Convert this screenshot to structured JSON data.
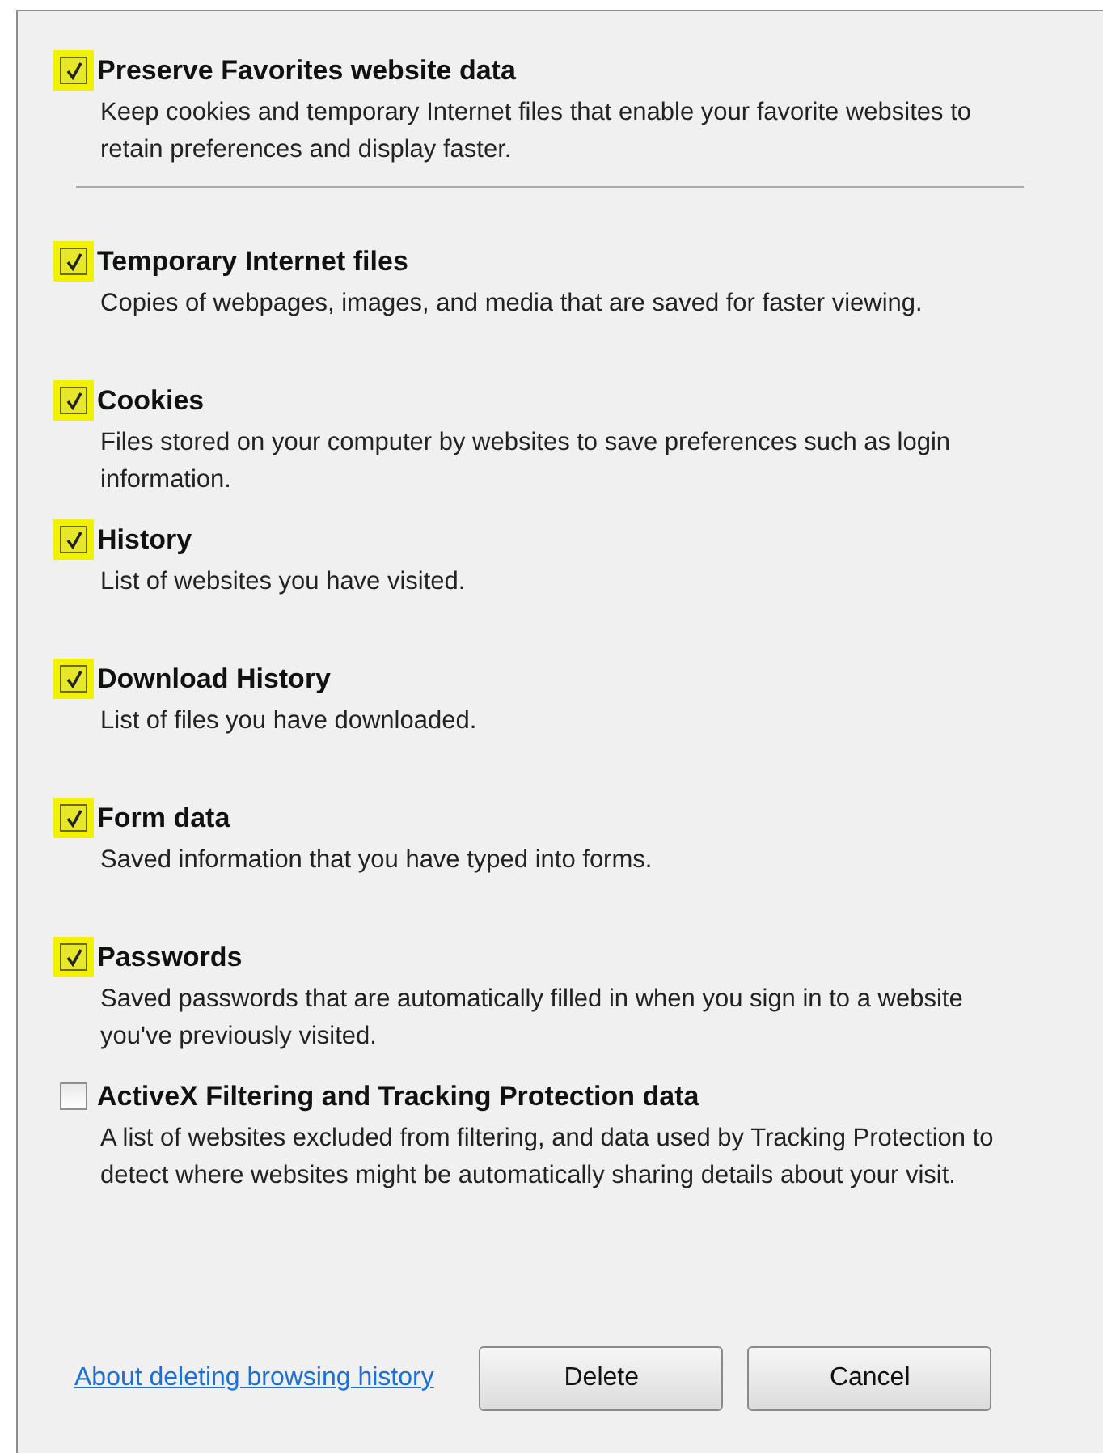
{
  "options": [
    {
      "label": "Preserve Favorites website data",
      "description": "Keep cookies and temporary Internet files that enable your favorite websites to retain preferences and display faster.",
      "checked": true
    },
    {
      "label": "Temporary Internet files",
      "description": "Copies of webpages, images, and media that are saved for faster viewing.",
      "checked": true
    },
    {
      "label": "Cookies",
      "description": "Files stored on your computer by websites to save preferences such as login information.",
      "checked": true
    },
    {
      "label": "History",
      "description": "List of websites you have visited.",
      "checked": true
    },
    {
      "label": "Download History",
      "description": "List of files you have downloaded.",
      "checked": true
    },
    {
      "label": "Form data",
      "description": "Saved information that you have typed into forms.",
      "checked": true
    },
    {
      "label": "Passwords",
      "description": "Saved passwords that are automatically filled in when you sign in to a website you've previously visited.",
      "checked": true
    },
    {
      "label": "ActiveX Filtering and Tracking Protection data",
      "description": "A list of websites excluded from filtering, and data used by Tracking Protection to detect where websites might be automatically sharing details about your visit.",
      "checked": false
    }
  ],
  "footer": {
    "link": "About deleting browsing history",
    "buttons": [
      "Delete",
      "Cancel"
    ]
  }
}
